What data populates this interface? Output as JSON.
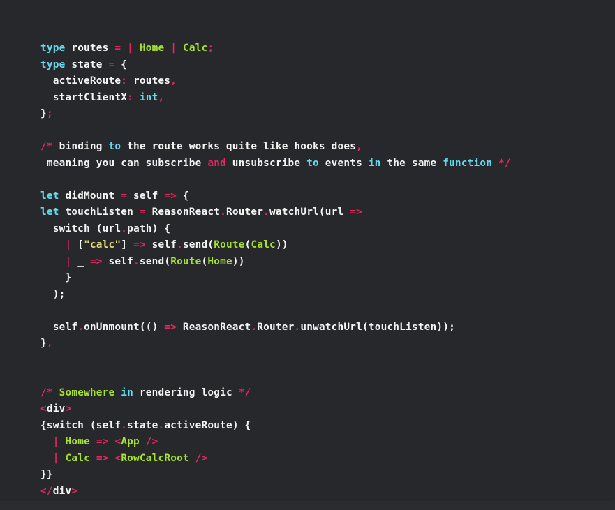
{
  "theme": {
    "page_background": "#2a2c2f",
    "card_background": "#26282c",
    "default_text": "#f4f4f4",
    "keyword_color": "#66d9ef",
    "operator_color": "#e6275e",
    "constructor_color": "#a6e22e",
    "string_color": "#e6db74"
  },
  "code": {
    "language": "reason",
    "lines": [
      [
        {
          "text": "type",
          "cls": "t-key"
        },
        {
          "text": " routes ",
          "cls": "t-plain"
        },
        {
          "text": "=",
          "cls": "t-op"
        },
        {
          "text": " ",
          "cls": "t-plain"
        },
        {
          "text": "|",
          "cls": "t-op"
        },
        {
          "text": " ",
          "cls": "t-plain"
        },
        {
          "text": "Home",
          "cls": "t-cons"
        },
        {
          "text": " ",
          "cls": "t-plain"
        },
        {
          "text": "|",
          "cls": "t-op"
        },
        {
          "text": " ",
          "cls": "t-plain"
        },
        {
          "text": "Calc",
          "cls": "t-cons"
        },
        {
          "text": ";",
          "cls": "t-op"
        }
      ],
      [
        {
          "text": "type",
          "cls": "t-key"
        },
        {
          "text": " state ",
          "cls": "t-plain"
        },
        {
          "text": "=",
          "cls": "t-op"
        },
        {
          "text": " {",
          "cls": "t-plain"
        }
      ],
      [
        {
          "text": "  activeRoute",
          "cls": "t-plain"
        },
        {
          "text": ":",
          "cls": "t-op"
        },
        {
          "text": " routes",
          "cls": "t-plain"
        },
        {
          "text": ",",
          "cls": "t-op"
        }
      ],
      [
        {
          "text": "  startClientX",
          "cls": "t-plain"
        },
        {
          "text": ":",
          "cls": "t-op"
        },
        {
          "text": " ",
          "cls": "t-plain"
        },
        {
          "text": "int",
          "cls": "t-key"
        },
        {
          "text": ",",
          "cls": "t-op"
        }
      ],
      [
        {
          "text": "}",
          "cls": "t-plain"
        },
        {
          "text": ";",
          "cls": "t-op"
        }
      ],
      [],
      [
        {
          "text": "/*",
          "cls": "t-op"
        },
        {
          "text": " binding ",
          "cls": "t-plain"
        },
        {
          "text": "to",
          "cls": "t-key"
        },
        {
          "text": " the route works quite like hooks does",
          "cls": "t-plain"
        },
        {
          "text": ",",
          "cls": "t-op"
        }
      ],
      [
        {
          "text": " meaning you can subscribe ",
          "cls": "t-plain"
        },
        {
          "text": "and",
          "cls": "t-op"
        },
        {
          "text": " unsubscribe ",
          "cls": "t-plain"
        },
        {
          "text": "to",
          "cls": "t-key"
        },
        {
          "text": " events ",
          "cls": "t-plain"
        },
        {
          "text": "in",
          "cls": "t-key"
        },
        {
          "text": " the same ",
          "cls": "t-plain"
        },
        {
          "text": "function",
          "cls": "t-key"
        },
        {
          "text": " ",
          "cls": "t-plain"
        },
        {
          "text": "*/",
          "cls": "t-op"
        }
      ],
      [],
      [
        {
          "text": "let",
          "cls": "t-key"
        },
        {
          "text": " didMount ",
          "cls": "t-plain"
        },
        {
          "text": "=",
          "cls": "t-op"
        },
        {
          "text": " self ",
          "cls": "t-plain"
        },
        {
          "text": "=>",
          "cls": "t-op"
        },
        {
          "text": " {",
          "cls": "t-plain"
        }
      ],
      [
        {
          "text": "let",
          "cls": "t-key"
        },
        {
          "text": " touchListen ",
          "cls": "t-plain"
        },
        {
          "text": "=",
          "cls": "t-op"
        },
        {
          "text": " ReasonReact",
          "cls": "t-plain"
        },
        {
          "text": ".",
          "cls": "t-op"
        },
        {
          "text": "Router",
          "cls": "t-plain"
        },
        {
          "text": ".",
          "cls": "t-op"
        },
        {
          "text": "watchUrl(url ",
          "cls": "t-plain"
        },
        {
          "text": "=>",
          "cls": "t-op"
        }
      ],
      [
        {
          "text": "  switch (url",
          "cls": "t-plain"
        },
        {
          "text": ".",
          "cls": "t-op"
        },
        {
          "text": "path) {",
          "cls": "t-plain"
        }
      ],
      [
        {
          "text": "    ",
          "cls": "t-plain"
        },
        {
          "text": "|",
          "cls": "t-op"
        },
        {
          "text": " [",
          "cls": "t-plain"
        },
        {
          "text": "\"calc\"",
          "cls": "t-str"
        },
        {
          "text": "] ",
          "cls": "t-plain"
        },
        {
          "text": "=>",
          "cls": "t-op"
        },
        {
          "text": " self",
          "cls": "t-plain"
        },
        {
          "text": ".",
          "cls": "t-op"
        },
        {
          "text": "send(",
          "cls": "t-plain"
        },
        {
          "text": "Route",
          "cls": "t-cons"
        },
        {
          "text": "(",
          "cls": "t-plain"
        },
        {
          "text": "Calc",
          "cls": "t-cons"
        },
        {
          "text": "))",
          "cls": "t-plain"
        }
      ],
      [
        {
          "text": "    ",
          "cls": "t-plain"
        },
        {
          "text": "|",
          "cls": "t-op"
        },
        {
          "text": " _ ",
          "cls": "t-plain"
        },
        {
          "text": "=>",
          "cls": "t-op"
        },
        {
          "text": " self",
          "cls": "t-plain"
        },
        {
          "text": ".",
          "cls": "t-op"
        },
        {
          "text": "send(",
          "cls": "t-plain"
        },
        {
          "text": "Route",
          "cls": "t-cons"
        },
        {
          "text": "(",
          "cls": "t-plain"
        },
        {
          "text": "Home",
          "cls": "t-cons"
        },
        {
          "text": "))",
          "cls": "t-plain"
        }
      ],
      [
        {
          "text": "    }",
          "cls": "t-plain"
        }
      ],
      [
        {
          "text": "  );",
          "cls": "t-plain"
        }
      ],
      [],
      [
        {
          "text": "  self",
          "cls": "t-plain"
        },
        {
          "text": ".",
          "cls": "t-op"
        },
        {
          "text": "onUnmount(() ",
          "cls": "t-plain"
        },
        {
          "text": "=>",
          "cls": "t-op"
        },
        {
          "text": " ReasonReact",
          "cls": "t-plain"
        },
        {
          "text": ".",
          "cls": "t-op"
        },
        {
          "text": "Router",
          "cls": "t-plain"
        },
        {
          "text": ".",
          "cls": "t-op"
        },
        {
          "text": "unwatchUrl(touchListen));",
          "cls": "t-plain"
        }
      ],
      [
        {
          "text": "}",
          "cls": "t-plain"
        },
        {
          "text": ",",
          "cls": "t-op"
        }
      ],
      [],
      [],
      [
        {
          "text": "/*",
          "cls": "t-op"
        },
        {
          "text": " ",
          "cls": "t-plain"
        },
        {
          "text": "Somewhere",
          "cls": "t-cons"
        },
        {
          "text": " ",
          "cls": "t-plain"
        },
        {
          "text": "in",
          "cls": "t-key"
        },
        {
          "text": " rendering logic ",
          "cls": "t-plain"
        },
        {
          "text": "*/",
          "cls": "t-op"
        }
      ],
      [
        {
          "text": "<",
          "cls": "t-op"
        },
        {
          "text": "div",
          "cls": "t-plain"
        },
        {
          "text": ">",
          "cls": "t-op"
        }
      ],
      [
        {
          "text": "{switch (self",
          "cls": "t-plain"
        },
        {
          "text": ".",
          "cls": "t-op"
        },
        {
          "text": "state",
          "cls": "t-plain"
        },
        {
          "text": ".",
          "cls": "t-op"
        },
        {
          "text": "activeRoute) {",
          "cls": "t-plain"
        }
      ],
      [
        {
          "text": "  ",
          "cls": "t-plain"
        },
        {
          "text": "|",
          "cls": "t-op"
        },
        {
          "text": " ",
          "cls": "t-plain"
        },
        {
          "text": "Home",
          "cls": "t-cons"
        },
        {
          "text": " ",
          "cls": "t-plain"
        },
        {
          "text": "=>",
          "cls": "t-op"
        },
        {
          "text": " ",
          "cls": "t-plain"
        },
        {
          "text": "<",
          "cls": "t-op"
        },
        {
          "text": "App",
          "cls": "t-cons"
        },
        {
          "text": " ",
          "cls": "t-plain"
        },
        {
          "text": "/>",
          "cls": "t-op"
        }
      ],
      [
        {
          "text": "  ",
          "cls": "t-plain"
        },
        {
          "text": "|",
          "cls": "t-op"
        },
        {
          "text": " ",
          "cls": "t-plain"
        },
        {
          "text": "Calc",
          "cls": "t-cons"
        },
        {
          "text": " ",
          "cls": "t-plain"
        },
        {
          "text": "=>",
          "cls": "t-op"
        },
        {
          "text": " ",
          "cls": "t-plain"
        },
        {
          "text": "<",
          "cls": "t-op"
        },
        {
          "text": "RowCalcRoot",
          "cls": "t-cons"
        },
        {
          "text": " ",
          "cls": "t-plain"
        },
        {
          "text": "/>",
          "cls": "t-op"
        }
      ],
      [
        {
          "text": "}}",
          "cls": "t-plain"
        }
      ],
      [
        {
          "text": "</",
          "cls": "t-op"
        },
        {
          "text": "div",
          "cls": "t-plain"
        },
        {
          "text": ">",
          "cls": "t-op"
        }
      ]
    ]
  }
}
